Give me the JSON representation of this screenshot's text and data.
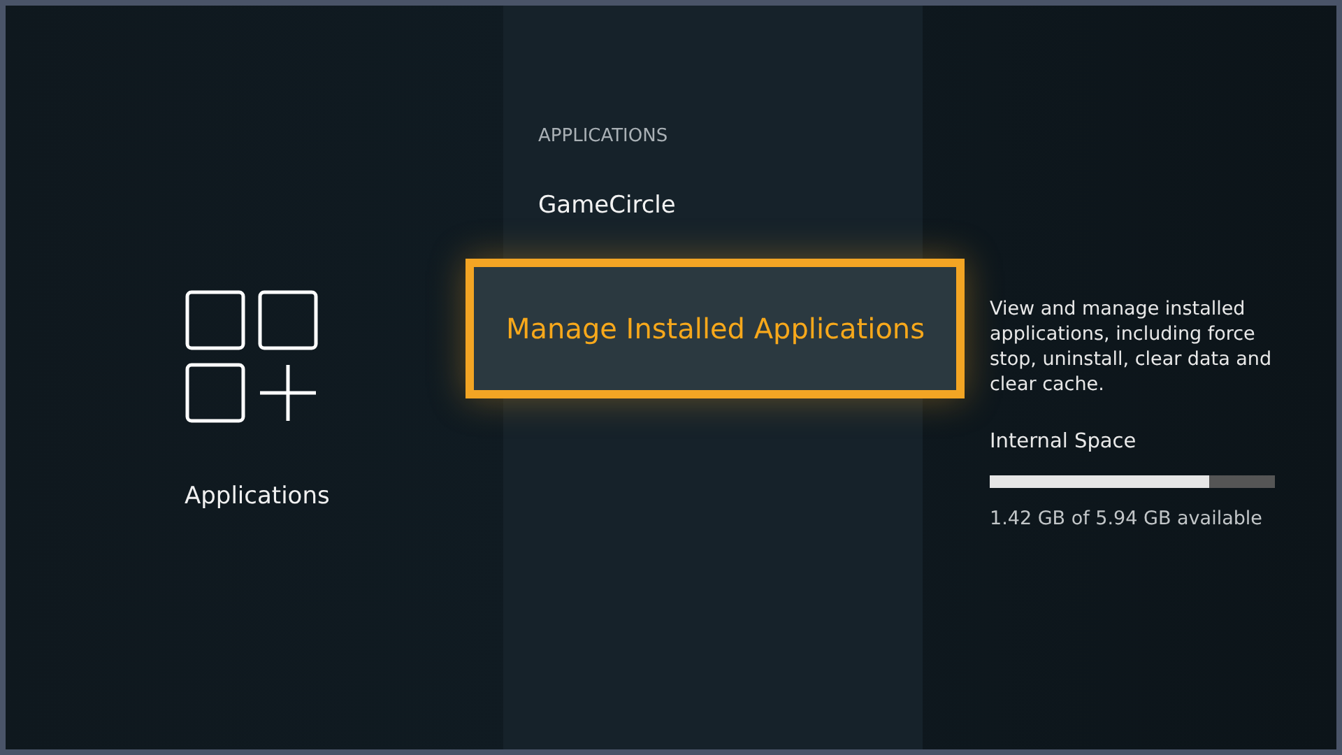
{
  "category": {
    "label": "Applications"
  },
  "menu": {
    "header": "APPLICATIONS",
    "items": [
      {
        "label": "GameCircle",
        "selected": false
      },
      {
        "label": "Manage Installed Applications",
        "selected": true
      }
    ]
  },
  "detail": {
    "description": "View and manage installed applications, including force stop, uninstall, clear data and clear cache.",
    "storage_title": "Internal Space",
    "storage": {
      "level": 0.77
    },
    "storage_reading": "1.42 GB of 5.94 GB available"
  }
}
